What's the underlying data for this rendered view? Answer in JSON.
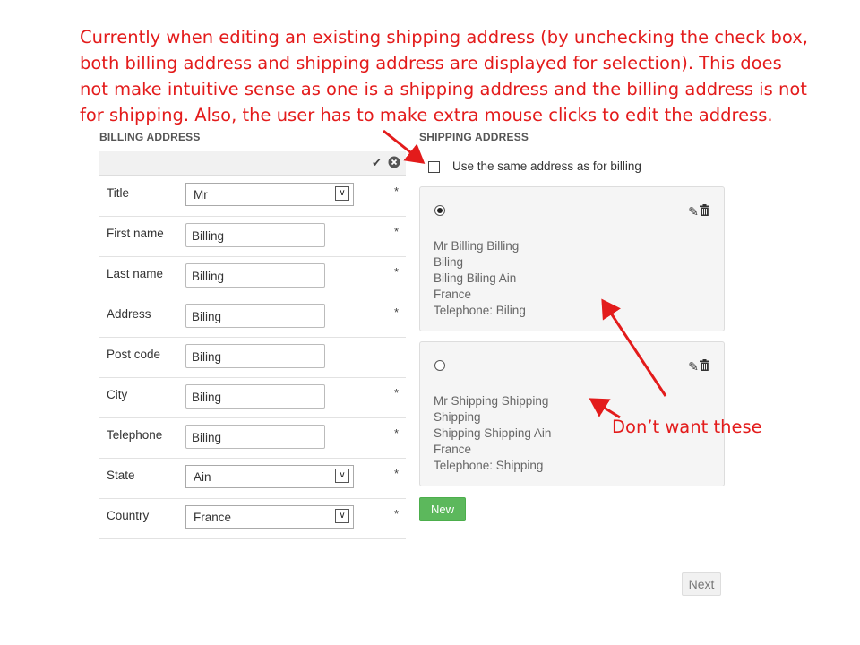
{
  "annotation": {
    "lines": [
      "Currently when editing an existing shipping address (by unchecking the check box,",
      "both billing address and shipping address are displayed for selection).  This does",
      "not make intuitive sense as one is a shipping address and the billing address is not",
      "for shipping.  Also, the user has to make extra mouse clicks to edit the address."
    ],
    "callout": "Don’t want these",
    "color": "#e31b1b"
  },
  "billing": {
    "title": "BILLING ADDRESS",
    "header_icons": [
      "checkmark-icon",
      "close-circle-icon"
    ],
    "fields": [
      {
        "label": "Title",
        "type": "select",
        "value": "Mr",
        "required": "*"
      },
      {
        "label": "First name",
        "type": "input",
        "value": "Billing",
        "required": "*"
      },
      {
        "label": "Last name",
        "type": "input",
        "value": "Billing",
        "required": "*"
      },
      {
        "label": "Address",
        "type": "input",
        "value": "Biling",
        "required": "*"
      },
      {
        "label": "Post code",
        "type": "input",
        "value": "Biling",
        "required": ""
      },
      {
        "label": "City",
        "type": "input",
        "value": "Biling",
        "required": "*"
      },
      {
        "label": "Telephone",
        "type": "input",
        "value": "Biling",
        "required": "*"
      },
      {
        "label": "State",
        "type": "select",
        "value": "Ain",
        "required": "*"
      },
      {
        "label": "Country",
        "type": "select",
        "value": "France",
        "required": "*"
      }
    ]
  },
  "shipping": {
    "title": "SHIPPING ADDRESS",
    "same_as_billing_label": "Use the same address as for billing",
    "same_as_billing_checked": false,
    "addresses": [
      {
        "selected": true,
        "lines": [
          "Mr Billing Billing",
          "Biling",
          "Biling Biling Ain",
          "France",
          "Telephone: Biling"
        ]
      },
      {
        "selected": false,
        "lines": [
          "Mr Shipping Shipping",
          "Shipping",
          "Shipping Shipping Ain",
          "France",
          "Telephone: Shipping"
        ]
      }
    ],
    "new_label": "New"
  },
  "next_label": "Next",
  "colors": {
    "new_button": "#5cb85c",
    "card_bg": "#f5f5f5"
  }
}
